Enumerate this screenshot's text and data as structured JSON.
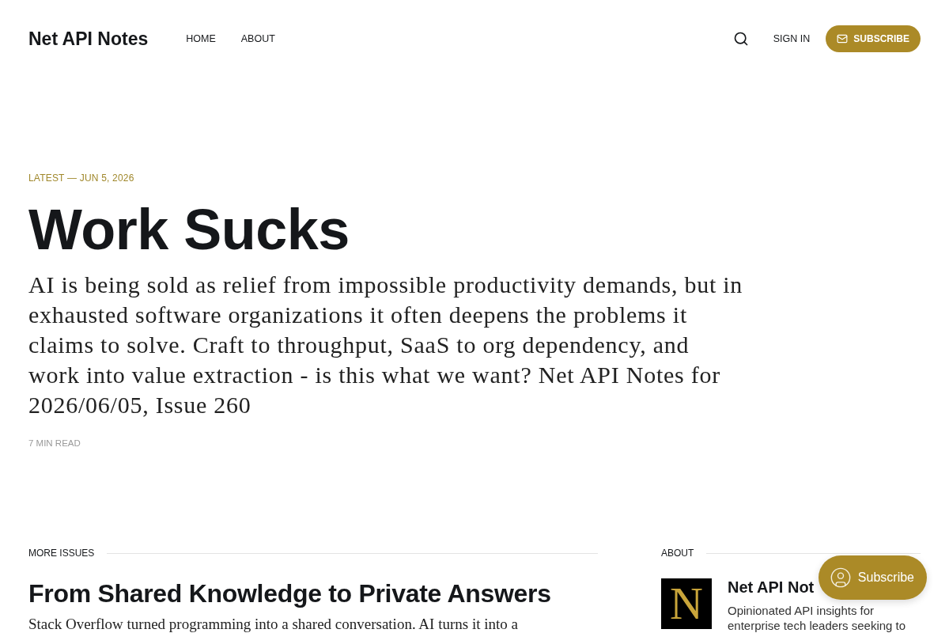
{
  "header": {
    "logo": "Net API Notes",
    "nav": [
      {
        "label": "HOME"
      },
      {
        "label": "ABOUT"
      }
    ],
    "sign_in": "SIGN IN",
    "subscribe_button": "SUBSCRIBE"
  },
  "hero": {
    "kicker": "LATEST — JUN 5, 2026",
    "title": "Work Sucks",
    "excerpt": "AI is being sold as relief from impossible productivity demands, but in exhausted software organizations it often deepens the problems it claims to solve. Craft to throughput, SaaS to org dependency, and work into value extraction - is this what we want? Net API Notes for 2026/06/05, Issue 260",
    "reading_time": "7 MIN READ"
  },
  "more_issues": {
    "heading": "MORE ISSUES",
    "posts": [
      {
        "title": "From Shared Knowledge to Private Answers",
        "excerpt": "Stack Overflow turned programming into a shared conversation. AI turns it into a"
      }
    ]
  },
  "about": {
    "heading": "ABOUT",
    "logo_letter": "N",
    "title": "Net API Not",
    "description": "Opinionated API insights for enterprise tech leaders seeking to"
  },
  "portal_button": {
    "label": "Subscribe"
  }
}
